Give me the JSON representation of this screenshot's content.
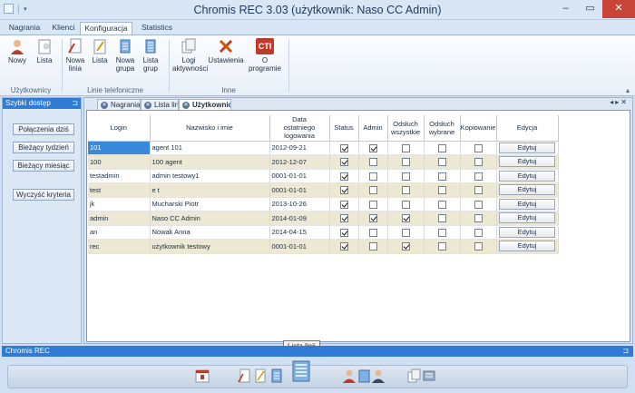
{
  "window": {
    "title": "Chromis REC 3.03 (użytkownik: Naso CC Admin)",
    "minimize": "–",
    "restore": "▭",
    "close": "✕"
  },
  "ribbon_tabs": [
    "Nagrania",
    "Klienci",
    "Konfiguracja",
    "Statistics"
  ],
  "ribbon": {
    "groups": [
      "Użytkownicy",
      "Linie telefoniczne",
      "Inne"
    ],
    "buttons": {
      "nowy": "Nowy",
      "lista_u": "Lista",
      "nowa_linia_1": "Nowa",
      "nowa_linia_2": "linia",
      "lista_l": "Lista",
      "nowa_grupa_1": "Nowa",
      "nowa_grupa_2": "grupa",
      "lista_grup_1": "Lista",
      "lista_grup_2": "grup",
      "logi_1": "Logi",
      "logi_2": "aktywności",
      "ustawienia": "Ustawienia",
      "o_programie_1": "O",
      "o_programie_2": "programie",
      "cti_logo": "CTI"
    }
  },
  "quick_panel": {
    "title": "Szybki dostęp",
    "buttons": [
      "Połączenia dziś",
      "Bieżący tydzień",
      "Bieżący miesiąc",
      "Wyczyść kryteria"
    ]
  },
  "doc_tabs": [
    "Nagrania",
    "Lista linii",
    "Użytkownicy"
  ],
  "table": {
    "headers": {
      "login": "Login",
      "name": "Nazwisko i imie",
      "date_1": "Data",
      "date_2": "ostatniego",
      "date_3": "logowania",
      "status": "Status",
      "admin": "Admin",
      "odsluch_w_1": "Odsłuch",
      "odsluch_w_2": "wszystkie",
      "odsluch_wy_1": "Odsłuch",
      "odsluch_wy_2": "wybrane",
      "kopiowanie": "Kopiowanie",
      "edycja": "Edycja"
    },
    "edit_label": "Edytuj",
    "rows": [
      {
        "login": "101",
        "name": " agent 101",
        "date": "2012-09-21",
        "status": true,
        "admin": true,
        "all": false,
        "sel": false,
        "copy": false
      },
      {
        "login": "100",
        "name": "100 agent",
        "date": "2012-12-07",
        "status": true,
        "admin": false,
        "all": false,
        "sel": false,
        "copy": false
      },
      {
        "login": "testadmin",
        "name": "admin testowy1",
        "date": "0001-01-01",
        "status": true,
        "admin": false,
        "all": false,
        "sel": false,
        "copy": false
      },
      {
        "login": "test",
        "name": "e t",
        "date": "0001-01-01",
        "status": true,
        "admin": false,
        "all": false,
        "sel": false,
        "copy": false
      },
      {
        "login": "jk",
        "name": "Mucharski Piotr",
        "date": "2013-10-26",
        "status": true,
        "admin": false,
        "all": false,
        "sel": false,
        "copy": false
      },
      {
        "login": "admin",
        "name": "Naso CC Admin",
        "date": "2014-01-09",
        "status": true,
        "admin": true,
        "all": true,
        "sel": false,
        "copy": false
      },
      {
        "login": "an",
        "name": "Nowak Anna",
        "date": "2014-04-15",
        "status": true,
        "admin": false,
        "all": false,
        "sel": false,
        "copy": false
      },
      {
        "login": "rec",
        "name": "użytkownik testowy",
        "date": "0001-01-01",
        "status": true,
        "admin": false,
        "all": true,
        "sel": false,
        "copy": false
      }
    ]
  },
  "bottom_panel": {
    "title": "Chromis REC",
    "tooltip": "Lista linii"
  },
  "colors": {
    "accent": "#2f7bd6",
    "close": "#c9453a",
    "row_alt": "#ece8d4",
    "selected": "#3b89db"
  }
}
